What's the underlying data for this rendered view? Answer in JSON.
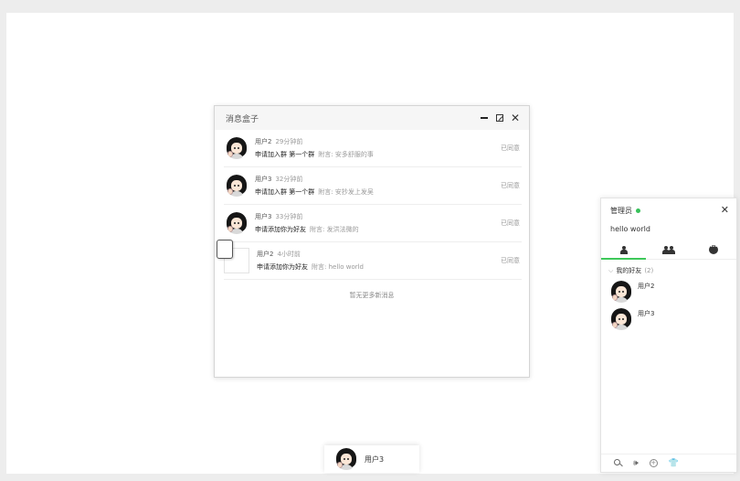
{
  "msgbox": {
    "title": "消息盒子",
    "close_glyph": "✕",
    "messages": [
      {
        "user": "用户2",
        "time": "29分钟前",
        "action": "申请加入群 第一个群",
        "note": "附言: 安多舒服的事",
        "status": "已同意",
        "avatar": "girl-avatar"
      },
      {
        "user": "用户3",
        "time": "32分钟前",
        "action": "申请加入群 第一个群",
        "note": "附言: 安抄发上发吴",
        "status": "已同意",
        "avatar": "girl-avatar"
      },
      {
        "user": "用户3",
        "time": "33分钟前",
        "action": "申请添加你为好友",
        "note": "附言: 发洪法微的",
        "status": "已同意",
        "avatar": "girl-avatar"
      },
      {
        "user": "用户2",
        "time": "4小时前",
        "action": "申请添加你为好友",
        "note": "附言: hello world",
        "status": "已同意",
        "avatar": "broken-image"
      }
    ],
    "no_more": "暂无更多新消息"
  },
  "panel": {
    "username": "管理员",
    "signature": "hello world",
    "close_glyph": "✕",
    "group": {
      "chevron": "⌵",
      "name": "我的好友",
      "count": "(2)"
    },
    "friends": [
      {
        "name": "用户2"
      },
      {
        "name": "用户3"
      }
    ],
    "footer_icons": [
      "search-icon",
      "speaker-icon",
      "add-icon",
      "skin-icon"
    ],
    "footer_glyphs": {
      "speaker": "🕪",
      "plus": "+",
      "skin": "👕"
    },
    "status_color": "#37c15a",
    "accent_color": "#3ec85a"
  },
  "minibar": {
    "name": "用户3"
  }
}
